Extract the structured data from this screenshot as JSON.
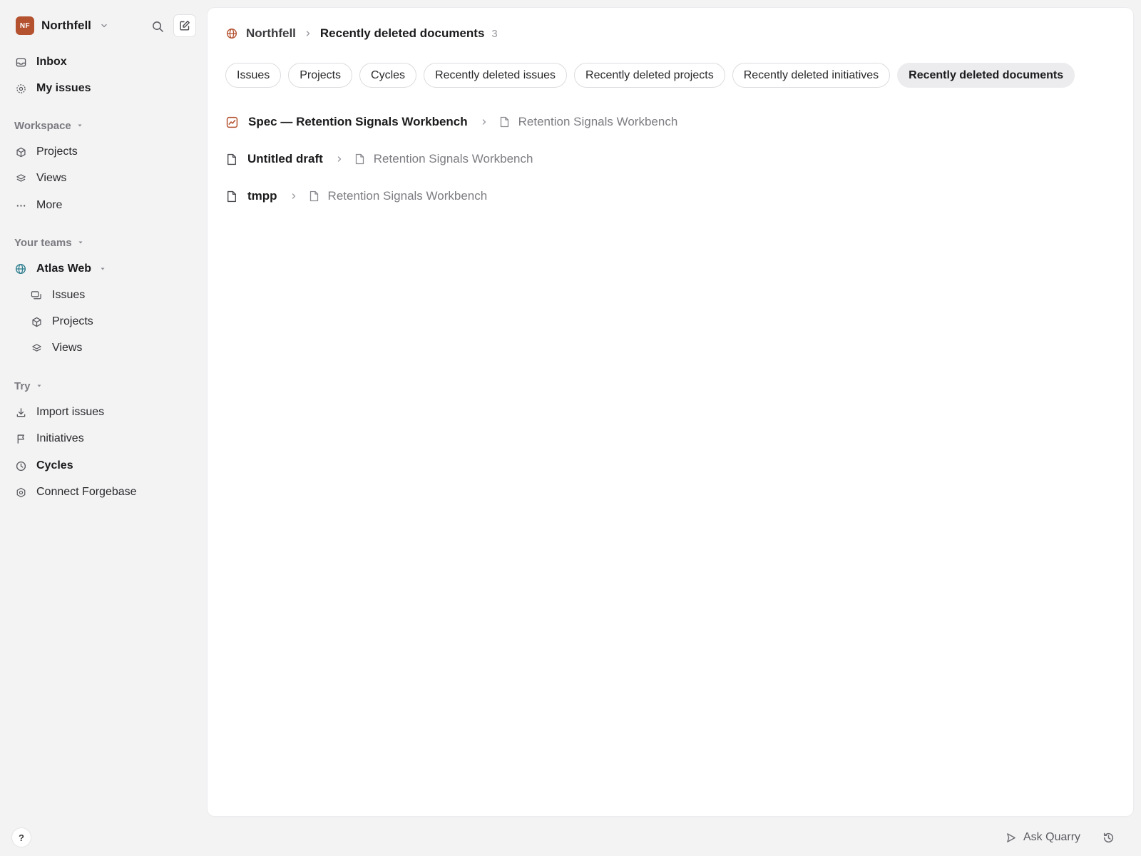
{
  "workspace": {
    "initials": "NF",
    "name": "Northfell"
  },
  "sidebar": {
    "primary": [
      {
        "label": "Inbox"
      },
      {
        "label": "My issues"
      }
    ],
    "workspace_section": {
      "label": "Workspace",
      "items": [
        {
          "label": "Projects"
        },
        {
          "label": "Views"
        },
        {
          "label": "More"
        }
      ]
    },
    "teams_section": {
      "label": "Your teams",
      "team": {
        "name": "Atlas Web",
        "items": [
          {
            "label": "Issues"
          },
          {
            "label": "Projects"
          },
          {
            "label": "Views"
          }
        ]
      }
    },
    "try_section": {
      "label": "Try",
      "items": [
        {
          "label": "Import issues"
        },
        {
          "label": "Initiatives"
        },
        {
          "label": "Cycles"
        },
        {
          "label": "Connect Forgebase"
        }
      ]
    },
    "help_label": "?"
  },
  "main": {
    "breadcrumb": {
      "root": "Northfell",
      "current": "Recently deleted documents",
      "count": "3"
    },
    "tabs": [
      {
        "label": "Issues"
      },
      {
        "label": "Projects"
      },
      {
        "label": "Cycles"
      },
      {
        "label": "Recently deleted issues"
      },
      {
        "label": "Recently deleted projects"
      },
      {
        "label": "Recently deleted initiatives"
      },
      {
        "label": "Recently deleted documents"
      }
    ],
    "documents": [
      {
        "title": "Spec — Retention Signals Workbench",
        "parent": "Retention Signals Workbench"
      },
      {
        "title": "Untitled draft",
        "parent": "Retention Signals Workbench"
      },
      {
        "title": "tmpp",
        "parent": "Retention Signals Workbench"
      }
    ]
  },
  "footer": {
    "ask_label": "Ask Quarry"
  },
  "colors": {
    "accent": "#b4512f",
    "team_icon": "#2f7f8f"
  }
}
